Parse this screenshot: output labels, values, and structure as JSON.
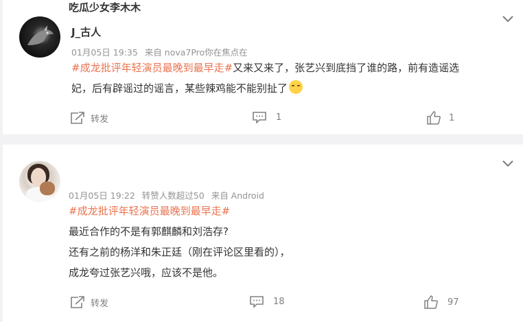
{
  "posts": [
    {
      "username": "J_古人",
      "date": "01月05日 19:35",
      "source": "来自 nova7Pro你在焦点在",
      "hashtag": "#成龙批评年轻演员最晚到最早走#",
      "text_line1": "又来又来了，张艺兴到底挡了谁的路，前有造谣选",
      "text_line2": "妃，后有辟谣过的谣言，某些辣鸡能不能别扯了",
      "emoji": "sleepy-face-emoji",
      "actions": {
        "repost_label": "转发",
        "comment_count": "1",
        "like_count": "1"
      }
    },
    {
      "username": "吃瓜少女李木木",
      "date": "01月05日 19:22",
      "reposts_info": "转赞人数超过50",
      "source": "来自 Android",
      "hashtag": "#成龙批评年轻演员最晚到最早走#",
      "lines": [
        "最近合作的不是有郭麒麟和刘浩存?",
        "还有之前的杨洋和朱正廷（刚在评论区里看的），",
        "成龙夸过张艺兴哦，应该不是他。"
      ],
      "actions": {
        "repost_label": "转发",
        "comment_count": "18",
        "like_count": "97"
      }
    }
  ],
  "colors": {
    "hashtag": "#eb7350",
    "meta": "#939393",
    "background": "#f2f2f5"
  },
  "icons": [
    "chevron-down-icon",
    "repost-icon",
    "comment-icon",
    "like-icon"
  ]
}
